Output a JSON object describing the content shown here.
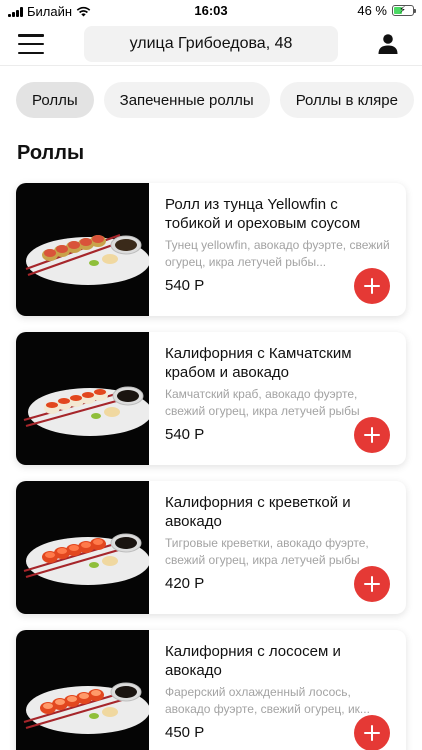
{
  "status_bar": {
    "carrier": "Билайн",
    "time": "16:03",
    "battery_percent": "46 %"
  },
  "header": {
    "address": "улица Грибоедова, 48",
    "icons": {
      "menu": "menu-icon",
      "profile": "user-icon"
    }
  },
  "categories": [
    "Роллы",
    "Запеченные роллы",
    "Роллы в кляре"
  ],
  "active_category": "Роллы",
  "section_title": "Роллы",
  "products": [
    {
      "name": " Ролл из тунца Yellowfin с тобикой и ореховым соусом",
      "description": "Тунец yellowfin, авокадо фуэрте, свежий огурец, икра летучей рыбы...",
      "price": "540 Р"
    },
    {
      "name": "Калифорния с Камчатским крабом и авокадо",
      "description": "Камчатский краб, авокадо фуэрте, свежий огурец, икра летучей рыбы",
      "price": "540 Р"
    },
    {
      "name": "Калифорния с креветкой и авокадо",
      "description": "Тигровые креветки, авокадо фуэрте, свежий огурец, икра летучей рыбы",
      "price": "420 Р"
    },
    {
      "name": "Калифорния с лососем и авокадо",
      "description": "Фарерский охлажденный лосось, авокадо фуэрте, свежий огурец, ик...",
      "price": "450 Р"
    }
  ],
  "colors": {
    "accent": "#e53935",
    "chip_bg": "#f2f2f2",
    "muted_text": "#a3a3a3"
  }
}
